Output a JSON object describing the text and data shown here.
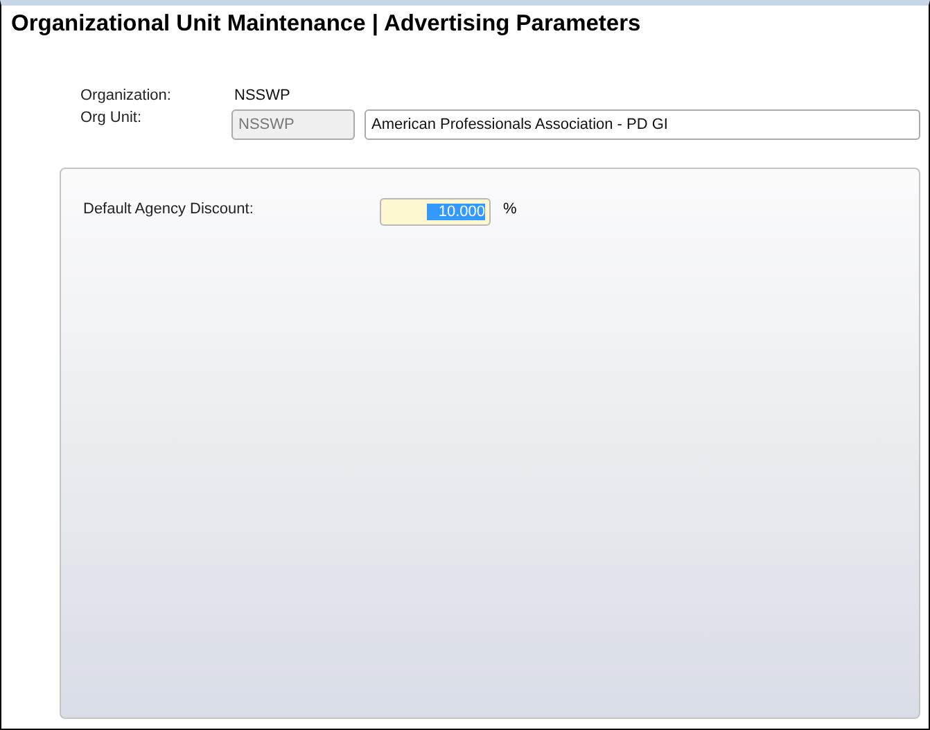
{
  "title": "Organizational Unit Maintenance | Advertising Parameters",
  "organization": {
    "label": "Organization:",
    "value": "NSSWP"
  },
  "org_unit": {
    "label": "Org Unit:",
    "code": "NSSWP",
    "code_disabled": true,
    "name": "American Professionals Association - PD GI"
  },
  "discount": {
    "label": "Default Agency Discount:",
    "value": "10.000",
    "value_selected": true,
    "unit": "%"
  }
}
